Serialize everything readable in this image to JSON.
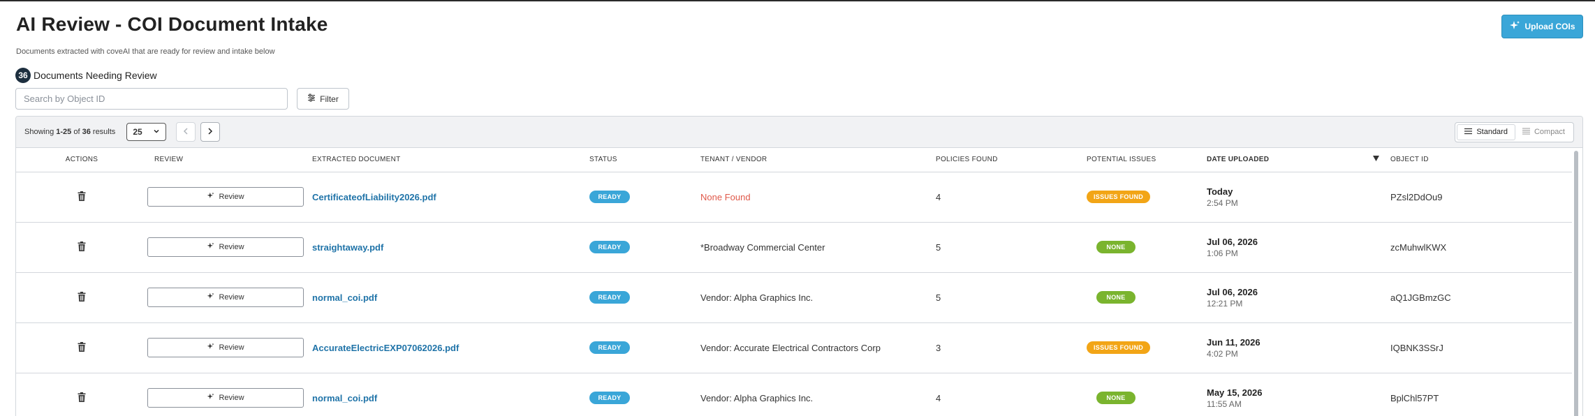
{
  "header": {
    "title": "AI Review - COI Document Intake",
    "subtitle": "Documents extracted with coveAI that are ready for review and intake below",
    "upload_label": "Upload COIs"
  },
  "summary": {
    "count": "36",
    "label": "Documents Needing Review"
  },
  "search": {
    "placeholder": "Search by Object ID",
    "value": ""
  },
  "filter": {
    "label": "Filter"
  },
  "toolbar": {
    "showing_prefix": "Showing ",
    "range": "1-25",
    "of": " of ",
    "total": "36",
    "suffix": " results",
    "page_size": "25",
    "views": [
      {
        "label": "Standard",
        "active": true
      },
      {
        "label": "Compact",
        "active": false
      }
    ]
  },
  "columns": [
    "ACTIONS",
    "REVIEW",
    "EXTRACTED DOCUMENT",
    "STATUS",
    "TENANT / VENDOR",
    "POLICIES FOUND",
    "POTENTIAL ISSUES",
    "DATE UPLOADED",
    "OBJECT ID"
  ],
  "review_label": "Review",
  "rows": [
    {
      "document": "CertificateofLiability2026.pdf",
      "status": "READY",
      "tenant_vendor": "None Found",
      "tenant_missing": true,
      "policies": "4",
      "issues": "ISSUES FOUND",
      "issue_type": "issues",
      "date": "Today",
      "time": "2:54 PM",
      "object_id": "PZsl2DdOu9"
    },
    {
      "document": "straightaway.pdf",
      "status": "READY",
      "tenant_vendor": "*Broadway Commercial Center",
      "tenant_missing": false,
      "policies": "5",
      "issues": "NONE",
      "issue_type": "none",
      "date": "Jul 06, 2026",
      "time": "1:06 PM",
      "object_id": "zcMuhwlKWX"
    },
    {
      "document": "normal_coi.pdf",
      "status": "READY",
      "tenant_vendor": "Vendor: Alpha Graphics Inc.",
      "tenant_missing": false,
      "policies": "5",
      "issues": "NONE",
      "issue_type": "none",
      "date": "Jul 06, 2026",
      "time": "12:21 PM",
      "object_id": "aQ1JGBmzGC"
    },
    {
      "document": "AccurateElectricEXP07062026.pdf",
      "status": "READY",
      "tenant_vendor": "Vendor: Accurate Electrical Contractors Corp",
      "tenant_missing": false,
      "policies": "3",
      "issues": "ISSUES FOUND",
      "issue_type": "issues",
      "date": "Jun 11, 2026",
      "time": "4:02 PM",
      "object_id": "IQBNK3SSrJ"
    },
    {
      "document": "normal_coi.pdf",
      "status": "READY",
      "tenant_vendor": "Vendor: Alpha Graphics Inc.",
      "tenant_missing": false,
      "policies": "4",
      "issues": "NONE",
      "issue_type": "none",
      "date": "May 15, 2026",
      "time": "11:55 AM",
      "object_id": "BplChl57PT"
    }
  ],
  "icons": {
    "upload": "sparkle-icon",
    "filter": "sliders-icon",
    "delete": "trash-icon",
    "review": "sparkle-icon",
    "sort": "sort-down-icon",
    "view_standard": "list-icon",
    "view_compact": "compact-list-icon"
  },
  "colors": {
    "accent": "#3aa6d8",
    "link": "#1f73a8",
    "issues": "#f2a516",
    "none": "#7ab42e",
    "error_text": "#e0594a",
    "badge_dark": "#1d2f3f"
  }
}
